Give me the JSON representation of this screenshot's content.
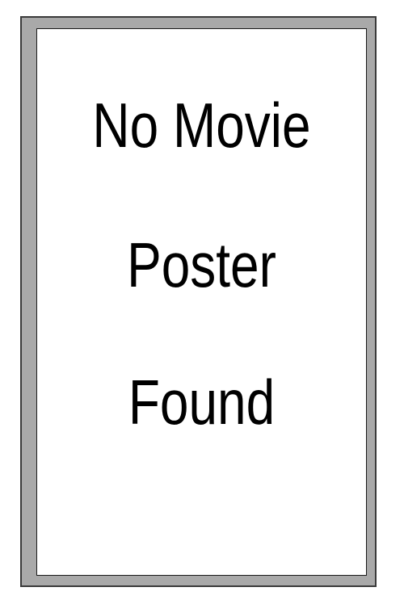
{
  "placeholder": {
    "lines": [
      "No Movie",
      "Poster",
      "Found"
    ]
  },
  "colors": {
    "frame": "#a9a9a9",
    "frame_border": "#3a3a3a",
    "inner_background": "#ffffff",
    "text": "#000000"
  }
}
